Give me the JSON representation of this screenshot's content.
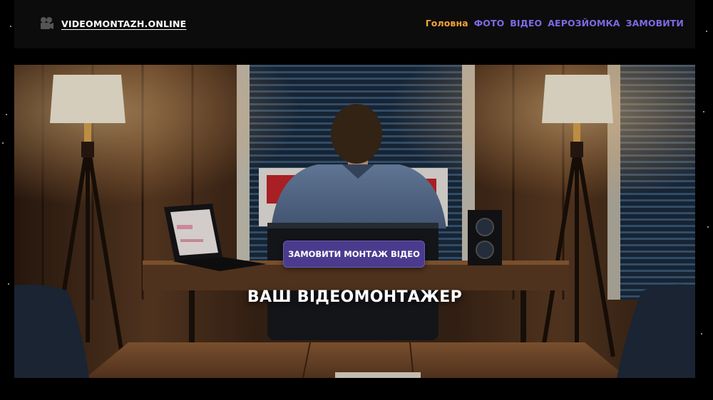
{
  "header": {
    "logo_text": "VIDEOMONTAZH.ONLINE",
    "logo_icon": "film-camera-icon"
  },
  "nav": {
    "items": [
      {
        "label": "Головна",
        "active": true
      },
      {
        "label": "ФОТО",
        "active": false
      },
      {
        "label": "ВІДЕО",
        "active": false
      },
      {
        "label": "АЕРОЗЙОМКА",
        "active": false
      },
      {
        "label": "ЗАМОВИТИ",
        "active": false
      }
    ]
  },
  "hero": {
    "cta_label": "ЗАМОВИТИ МОНТАЖ ВІДЕО",
    "title": "ВАШ ВІДЕОМОНТАЖЕР"
  },
  "colors": {
    "active_nav": "#f2a33a",
    "nav": "#7d6ae6",
    "cta_bg": "#4b3b8e",
    "header_bg": "#0c0c0c"
  }
}
